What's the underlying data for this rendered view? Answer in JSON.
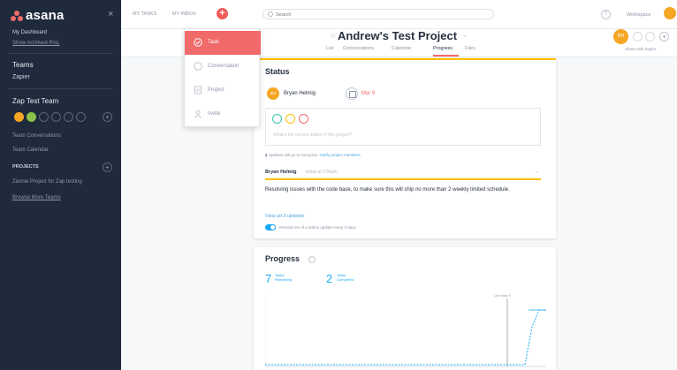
{
  "sidebar": {
    "logo": "asana",
    "close": "×",
    "dashboard": "My Dashboard",
    "show_archived": "Show Archived Proj.",
    "teams_heading": "Teams",
    "team_zapier": "Zapier",
    "team_zap_test": "Zap Test Team",
    "member_initials": [
      "BH",
      "DH",
      "A",
      "A",
      "A",
      "A"
    ],
    "team_conversations": "Team Conversations",
    "team_calendar": "Team Calendar",
    "projects_heading": "PROJECTS",
    "project_1": "Zennie Project for Zap testing",
    "browse_more": "Browse More Teams"
  },
  "topbar": {
    "my_tasks": "MY TASKS",
    "my_inbox": "MY INBOX",
    "search_placeholder": "Search",
    "help": "?",
    "user_label": "Workspace"
  },
  "dropdown": {
    "items": [
      {
        "label": "Task",
        "icon": "check-circle-icon"
      },
      {
        "label": "Conversation",
        "icon": "chat-icon"
      },
      {
        "label": "Project",
        "icon": "clipboard-icon"
      },
      {
        "label": "Invite",
        "icon": "person-icon"
      }
    ]
  },
  "project": {
    "star": "☆",
    "title": "Andrew's Test Project",
    "tabs": [
      "List",
      "Conversations",
      "Calendar",
      "Progress",
      "Files"
    ],
    "active_tab": "Progress",
    "owner_initials": "BH",
    "header_caption": "Share with Zapier"
  },
  "status": {
    "title": "Status",
    "owner_name": "Bryan Helmig",
    "due": "Mar 9",
    "placeholder": "What's the current status of this project?",
    "note": "Updates will go to everyone.",
    "note_link": "Notify project members",
    "update_author": "Bryan Helmig",
    "update_time": "today at 2:56pm",
    "update_text": "Resolving issues with the code base, to make sure this will ship no more than 2 weekly limited schedule.",
    "view_all": "View all 3 updates",
    "toggle_label": "Remind me of a status update every 2 days"
  },
  "progress": {
    "title": "Progress",
    "remaining_count": "7",
    "remaining_label_1": "Tasks",
    "remaining_label_2": "Remaining",
    "completed_count": "2",
    "completed_label_1": "Tasks",
    "completed_label_2": "Completed",
    "marker_label": "Live Mar 9"
  },
  "colors": {
    "accent": "#f06a6a",
    "status_yellow": "#fcbd01",
    "blue": "#14aaf5",
    "sidebar": "#1f2a3c"
  }
}
